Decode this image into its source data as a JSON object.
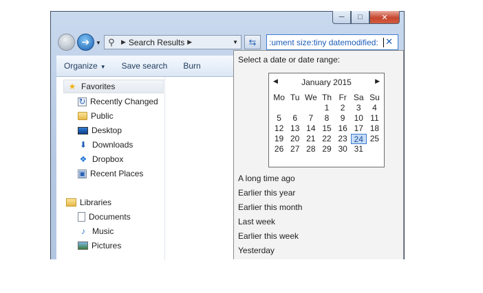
{
  "window": {
    "minimize_icon": "minimize-icon",
    "maximize_icon": "maximize-icon",
    "close_icon": "close-icon"
  },
  "nav": {
    "address_text": "Search Results",
    "search_query": ":ument size:tiny datemodified:"
  },
  "toolbar": {
    "organize": "Organize",
    "save_search": "Save search",
    "burn": "Burn"
  },
  "sidebar": {
    "favorites": "Favorites",
    "favorite_items": [
      "Recently Changed",
      "Public",
      "Desktop",
      "Downloads",
      "Dropbox",
      "Recent Places"
    ],
    "libraries": "Libraries",
    "library_items": [
      "Documents",
      "Music",
      "Pictures"
    ]
  },
  "date_picker": {
    "title": "Select a date or date range:",
    "month_label": "January 2015",
    "weekdays": [
      "Mo",
      "Tu",
      "We",
      "Th",
      "Fr",
      "Sa",
      "Su"
    ],
    "weeks": [
      [
        "",
        "",
        "",
        "1",
        "2",
        "3",
        "4"
      ],
      [
        "5",
        "6",
        "7",
        "8",
        "9",
        "10",
        "11"
      ],
      [
        "12",
        "13",
        "14",
        "15",
        "16",
        "17",
        "18"
      ],
      [
        "19",
        "20",
        "21",
        "22",
        "23",
        "24",
        "25"
      ],
      [
        "26",
        "27",
        "28",
        "29",
        "30",
        "31",
        ""
      ]
    ],
    "selected_day": "24",
    "presets": [
      "A long time ago",
      "Earlier this year",
      "Earlier this month",
      "Last week",
      "Earlier this week",
      "Yesterday"
    ]
  }
}
